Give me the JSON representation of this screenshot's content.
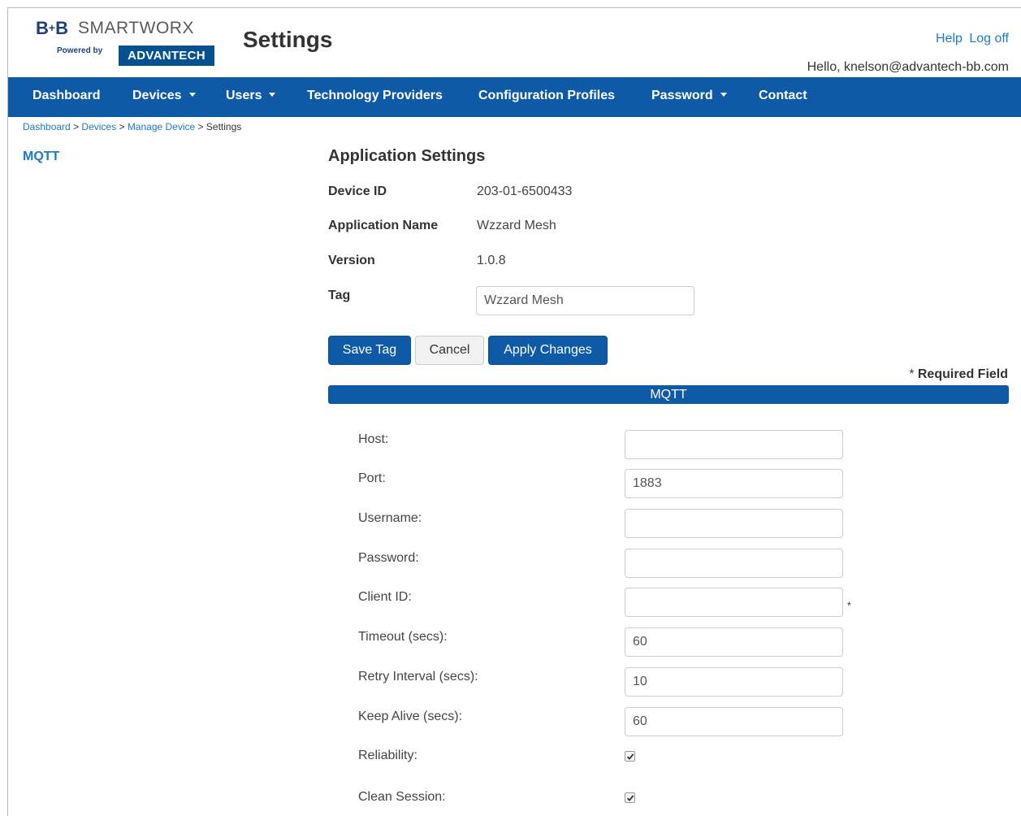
{
  "brand": {
    "bb": "B+B",
    "smartworx": "SMARTWORX",
    "powered_by": "Powered by",
    "advantech": "ADVANTECH",
    "brand_color": "#1e3f7a",
    "advantech_color": "#05508f"
  },
  "header": {
    "title": "Settings",
    "help": "Help",
    "logoff": "Log off",
    "greeting": "Hello, knelson@advantech-bb.com"
  },
  "nav": {
    "color": "#0e5aa7",
    "items": [
      {
        "label": "Dashboard",
        "dropdown": false
      },
      {
        "label": "Devices",
        "dropdown": true
      },
      {
        "label": "Users",
        "dropdown": true
      },
      {
        "label": "Technology Providers",
        "dropdown": false
      },
      {
        "label": "Configuration Profiles",
        "dropdown": false
      },
      {
        "label": "Password",
        "dropdown": true
      },
      {
        "label": "Contact",
        "dropdown": false
      }
    ]
  },
  "breadcrumb": {
    "items": [
      "Dashboard",
      "Devices",
      "Manage Device"
    ],
    "separator": ">",
    "current": "Settings"
  },
  "sidebar": {
    "items": [
      {
        "label": "MQTT"
      }
    ]
  },
  "app_settings": {
    "title": "Application Settings",
    "device_id_label": "Device ID",
    "device_id": "203-01-6500433",
    "app_name_label": "Application Name",
    "app_name": "Wzzard Mesh",
    "version_label": "Version",
    "version": "1.0.8",
    "tag_label": "Tag",
    "tag_value": "Wzzard Mesh"
  },
  "buttons": {
    "save_tag": "Save Tag",
    "cancel": "Cancel",
    "apply": "Apply Changes"
  },
  "required_note": {
    "asterisk": "*",
    "text": "Required Field"
  },
  "mqtt": {
    "section_title": "MQTT",
    "host_label": "Host:",
    "host_value": "",
    "port_label": "Port:",
    "port_value": "1883",
    "username_label": "Username:",
    "username_value": "",
    "password_label": "Password:",
    "password_value": "",
    "client_id_label": "Client ID:",
    "client_id_value": "",
    "client_id_required": "*",
    "timeout_label": "Timeout (secs):",
    "timeout_value": "60",
    "retry_label": "Retry Interval (secs):",
    "retry_value": "10",
    "keepalive_label": "Keep Alive (secs):",
    "keepalive_value": "60",
    "reliability_label": "Reliability:",
    "reliability_checked": true,
    "clean_session_label": "Clean Session:",
    "clean_session_checked": true
  }
}
